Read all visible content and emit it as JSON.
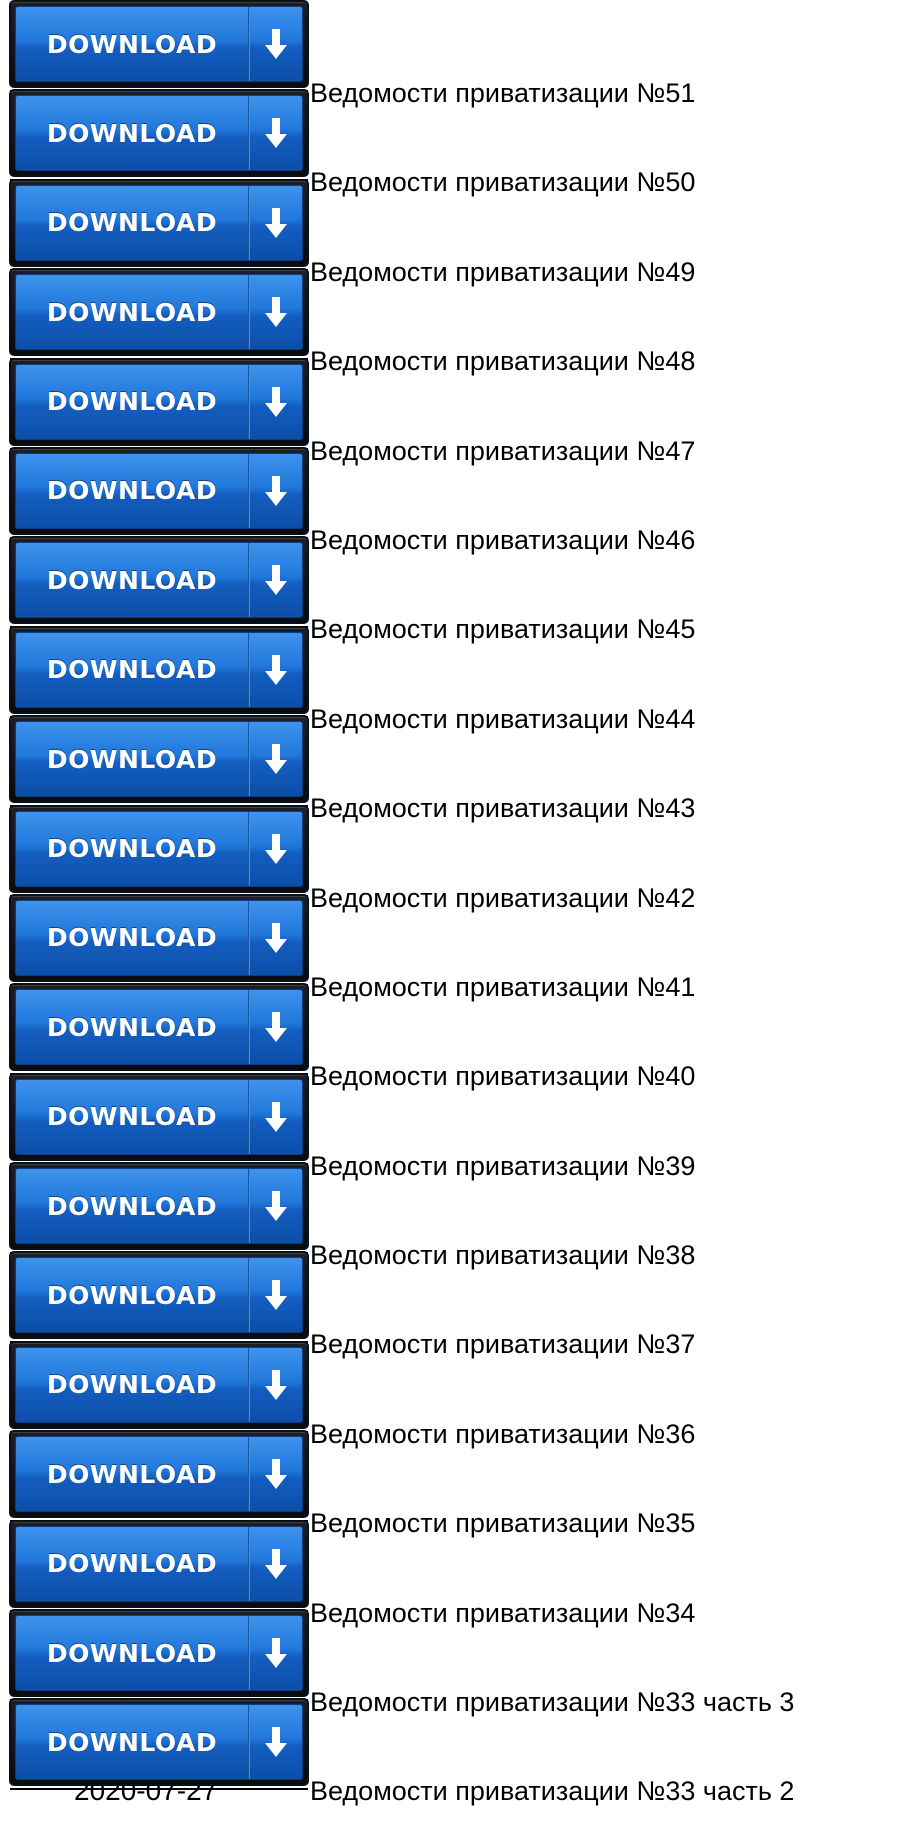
{
  "download_button": {
    "label": "DOWNLOAD",
    "icon": "arrow-down-icon",
    "colors": {
      "top": "#3f93ec",
      "bottom": "#0c4ea7",
      "frame": "#0b0f16"
    }
  },
  "items": [
    {
      "date": "",
      "title": "Ведомости приватизации №51"
    },
    {
      "date": "",
      "title": "Ведомости приватизации №50"
    },
    {
      "date": "",
      "title": "Ведомости приватизации №49"
    },
    {
      "date": "",
      "title": "Ведомости приватизации №48"
    },
    {
      "date": "",
      "title": "Ведомости приватизации №47"
    },
    {
      "date": "",
      "title": "Ведомости приватизации №46"
    },
    {
      "date": "",
      "title": "Ведомости приватизации №45"
    },
    {
      "date": "",
      "title": "Ведомости приватизации №44"
    },
    {
      "date": "",
      "title": "Ведомости приватизации №43"
    },
    {
      "date": "",
      "title": "Ведомости приватизации №42"
    },
    {
      "date": "",
      "title": "Ведомости приватизации №41"
    },
    {
      "date": "",
      "title": "Ведомости приватизации №40"
    },
    {
      "date": "",
      "title": "Ведомости приватизации №39"
    },
    {
      "date": "",
      "title": "Ведомости приватизации №38"
    },
    {
      "date": "",
      "title": "Ведомости приватизации №37"
    },
    {
      "date": "",
      "title": "Ведомости приватизации №36"
    },
    {
      "date": "",
      "title": "Ведомости приватизации №35"
    },
    {
      "date": "",
      "title": "Ведомости приватизации №34"
    },
    {
      "date": "",
      "title": "Ведомости приватизации №33 часть 3"
    },
    {
      "date": "2020-07-27",
      "title": "Ведомости приватизации №33 часть 2"
    }
  ]
}
